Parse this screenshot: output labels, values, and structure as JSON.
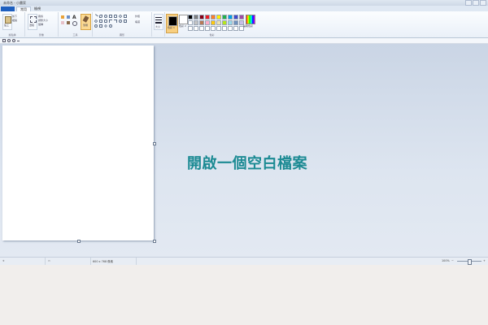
{
  "window": {
    "title": "未命名 - 小畫家"
  },
  "menu": {
    "tabs": [
      "常用",
      "檢視"
    ],
    "active": "常用"
  },
  "ribbon": {
    "groups": {
      "clipboard": {
        "label": "剪貼簿",
        "paste": "貼上",
        "cut": "剪下",
        "copy": "複製"
      },
      "image": {
        "label": "影像",
        "select": "選取",
        "crop": "裁剪",
        "resize": "調整大小",
        "rotate": "旋轉"
      },
      "tools": {
        "label": "工具",
        "brushes": "筆刷"
      },
      "shapes": {
        "label": "圖形",
        "outline": "外框",
        "fill": "填滿"
      },
      "size": {
        "label": "大小"
      },
      "colors": {
        "label": "色彩",
        "color1": "色彩 1",
        "color2": "色彩 2",
        "edit": "編輯色彩",
        "palette_row1": [
          "#000000",
          "#7f7f7f",
          "#880015",
          "#ed1c24",
          "#ff7f27",
          "#fff200",
          "#22b14c",
          "#00a2e8",
          "#3f48cc",
          "#a349a4"
        ],
        "palette_row2": [
          "#ffffff",
          "#c3c3c3",
          "#b97a57",
          "#ffaec9",
          "#ffc90e",
          "#efe4b0",
          "#b5e61d",
          "#99d9ea",
          "#7092be",
          "#c8bfe7"
        ],
        "palette_row3": [
          "#ffffff",
          "#ffffff",
          "#ffffff",
          "#ffffff",
          "#ffffff",
          "#ffffff",
          "#ffffff",
          "#ffffff",
          "#ffffff",
          "#ffffff"
        ]
      }
    }
  },
  "canvas": {
    "caption": "開啟一個空白檔案"
  },
  "status": {
    "size": "600 x 768 像素",
    "zoom": "100%"
  }
}
